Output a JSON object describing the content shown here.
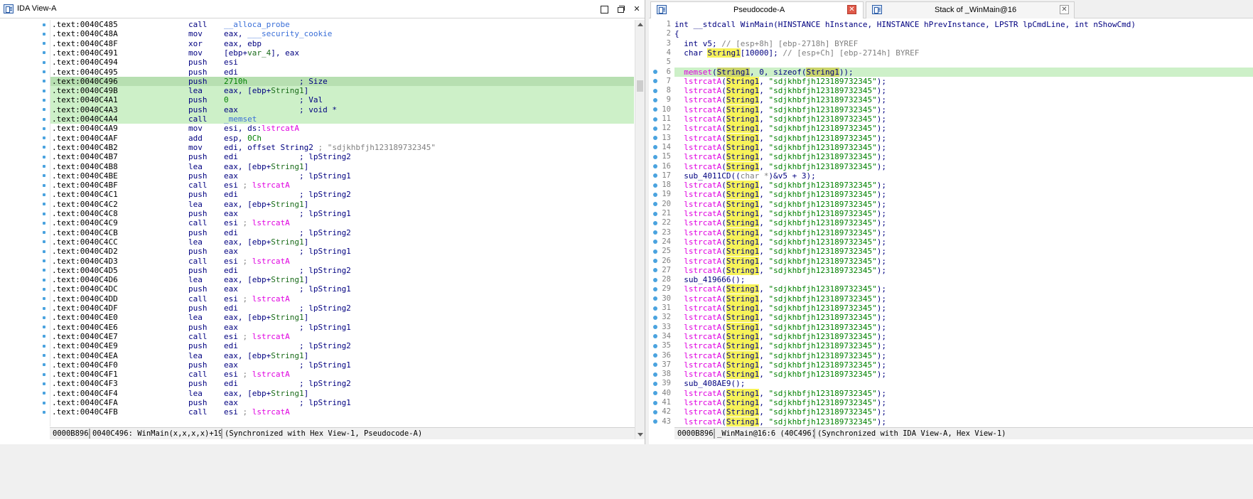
{
  "ida_view": {
    "title": "IDA View-A",
    "rows": [
      {
        "addr": ".text:0040C485",
        "mn": "call",
        "op": [
          [
            "func",
            "__alloca_probe"
          ]
        ],
        "cls": ""
      },
      {
        "addr": ".text:0040C48A",
        "mn": "mov",
        "op": [
          [
            "",
            "eax, "
          ],
          [
            "func",
            "___security_cookie"
          ]
        ],
        "cls": ""
      },
      {
        "addr": ".text:0040C48F",
        "mn": "xor",
        "op": [
          [
            "",
            "eax, ebp"
          ]
        ],
        "cls": ""
      },
      {
        "addr": ".text:0040C491",
        "mn": "mov",
        "op": [
          [
            "",
            "[ebp+"
          ],
          [
            "var",
            "var_4"
          ],
          [
            "",
            "], eax"
          ]
        ],
        "cls": ""
      },
      {
        "addr": ".text:0040C494",
        "mn": "push",
        "op": [
          [
            "",
            "esi"
          ]
        ],
        "cls": ""
      },
      {
        "addr": ".text:0040C495",
        "mn": "push",
        "op": [
          [
            "",
            "edi"
          ]
        ],
        "cls": ""
      },
      {
        "addr": ".text:0040C496",
        "mn": "push",
        "op": [
          [
            "num",
            "2710h"
          ],
          [
            "",
            "           ; Size"
          ]
        ],
        "cls": "cur"
      },
      {
        "addr": ".text:0040C49B",
        "mn": "lea",
        "op": [
          [
            "",
            "eax, [ebp+"
          ],
          [
            "var",
            "String1"
          ],
          [
            "",
            "]"
          ]
        ],
        "cls": "hl"
      },
      {
        "addr": ".text:0040C4A1",
        "mn": "push",
        "op": [
          [
            "num",
            "0"
          ],
          [
            "",
            "               ; Val"
          ]
        ],
        "cls": "hl"
      },
      {
        "addr": ".text:0040C4A3",
        "mn": "push",
        "op": [
          [
            "",
            "eax             ; void *"
          ]
        ],
        "cls": "hl"
      },
      {
        "addr": ".text:0040C4A4",
        "mn": "call",
        "op": [
          [
            "func",
            "_memset"
          ]
        ],
        "cls": "hl"
      },
      {
        "addr": ".text:0040C4A9",
        "mn": "mov",
        "op": [
          [
            "",
            "esi, ds:"
          ],
          [
            "imp",
            "lstrcatA"
          ]
        ],
        "cls": ""
      },
      {
        "addr": ".text:0040C4AF",
        "mn": "add",
        "op": [
          [
            "",
            "esp, "
          ],
          [
            "num",
            "0Ch"
          ]
        ],
        "cls": ""
      },
      {
        "addr": ".text:0040C4B2",
        "mn": "mov",
        "op": [
          [
            "",
            "edi, offset String2 "
          ],
          [
            "cm",
            "; \"sdjkhbfjh123189732345\""
          ]
        ],
        "cls": ""
      },
      {
        "addr": ".text:0040C4B7",
        "mn": "push",
        "op": [
          [
            "",
            "edi             ; lpString2"
          ]
        ],
        "cls": ""
      },
      {
        "addr": ".text:0040C4B8",
        "mn": "lea",
        "op": [
          [
            "",
            "eax, [ebp+"
          ],
          [
            "var",
            "String1"
          ],
          [
            "",
            "]"
          ]
        ],
        "cls": ""
      },
      {
        "addr": ".text:0040C4BE",
        "mn": "push",
        "op": [
          [
            "",
            "eax             ; lpString1"
          ]
        ],
        "cls": ""
      },
      {
        "addr": ".text:0040C4BF",
        "mn": "call",
        "op": [
          [
            "",
            "esi "
          ],
          [
            "cm",
            "; "
          ],
          [
            "imp",
            "lstrcatA"
          ]
        ],
        "cls": ""
      },
      {
        "addr": ".text:0040C4C1",
        "mn": "push",
        "op": [
          [
            "",
            "edi             ; lpString2"
          ]
        ],
        "cls": ""
      },
      {
        "addr": ".text:0040C4C2",
        "mn": "lea",
        "op": [
          [
            "",
            "eax, [ebp+"
          ],
          [
            "var",
            "String1"
          ],
          [
            "",
            "]"
          ]
        ],
        "cls": ""
      },
      {
        "addr": ".text:0040C4C8",
        "mn": "push",
        "op": [
          [
            "",
            "eax             ; lpString1"
          ]
        ],
        "cls": ""
      },
      {
        "addr": ".text:0040C4C9",
        "mn": "call",
        "op": [
          [
            "",
            "esi "
          ],
          [
            "cm",
            "; "
          ],
          [
            "imp",
            "lstrcatA"
          ]
        ],
        "cls": ""
      },
      {
        "addr": ".text:0040C4CB",
        "mn": "push",
        "op": [
          [
            "",
            "edi             ; lpString2"
          ]
        ],
        "cls": ""
      },
      {
        "addr": ".text:0040C4CC",
        "mn": "lea",
        "op": [
          [
            "",
            "eax, [ebp+"
          ],
          [
            "var",
            "String1"
          ],
          [
            "",
            "]"
          ]
        ],
        "cls": ""
      },
      {
        "addr": ".text:0040C4D2",
        "mn": "push",
        "op": [
          [
            "",
            "eax             ; lpString1"
          ]
        ],
        "cls": ""
      },
      {
        "addr": ".text:0040C4D3",
        "mn": "call",
        "op": [
          [
            "",
            "esi "
          ],
          [
            "cm",
            "; "
          ],
          [
            "imp",
            "lstrcatA"
          ]
        ],
        "cls": ""
      },
      {
        "addr": ".text:0040C4D5",
        "mn": "push",
        "op": [
          [
            "",
            "edi             ; lpString2"
          ]
        ],
        "cls": ""
      },
      {
        "addr": ".text:0040C4D6",
        "mn": "lea",
        "op": [
          [
            "",
            "eax, [ebp+"
          ],
          [
            "var",
            "String1"
          ],
          [
            "",
            "]"
          ]
        ],
        "cls": ""
      },
      {
        "addr": ".text:0040C4DC",
        "mn": "push",
        "op": [
          [
            "",
            "eax             ; lpString1"
          ]
        ],
        "cls": ""
      },
      {
        "addr": ".text:0040C4DD",
        "mn": "call",
        "op": [
          [
            "",
            "esi "
          ],
          [
            "cm",
            "; "
          ],
          [
            "imp",
            "lstrcatA"
          ]
        ],
        "cls": ""
      },
      {
        "addr": ".text:0040C4DF",
        "mn": "push",
        "op": [
          [
            "",
            "edi             ; lpString2"
          ]
        ],
        "cls": ""
      },
      {
        "addr": ".text:0040C4E0",
        "mn": "lea",
        "op": [
          [
            "",
            "eax, [ebp+"
          ],
          [
            "var",
            "String1"
          ],
          [
            "",
            "]"
          ]
        ],
        "cls": ""
      },
      {
        "addr": ".text:0040C4E6",
        "mn": "push",
        "op": [
          [
            "",
            "eax             ; lpString1"
          ]
        ],
        "cls": ""
      },
      {
        "addr": ".text:0040C4E7",
        "mn": "call",
        "op": [
          [
            "",
            "esi "
          ],
          [
            "cm",
            "; "
          ],
          [
            "imp",
            "lstrcatA"
          ]
        ],
        "cls": ""
      },
      {
        "addr": ".text:0040C4E9",
        "mn": "push",
        "op": [
          [
            "",
            "edi             ; lpString2"
          ]
        ],
        "cls": ""
      },
      {
        "addr": ".text:0040C4EA",
        "mn": "lea",
        "op": [
          [
            "",
            "eax, [ebp+"
          ],
          [
            "var",
            "String1"
          ],
          [
            "",
            "]"
          ]
        ],
        "cls": ""
      },
      {
        "addr": ".text:0040C4F0",
        "mn": "push",
        "op": [
          [
            "",
            "eax             ; lpString1"
          ]
        ],
        "cls": ""
      },
      {
        "addr": ".text:0040C4F1",
        "mn": "call",
        "op": [
          [
            "",
            "esi "
          ],
          [
            "cm",
            "; "
          ],
          [
            "imp",
            "lstrcatA"
          ]
        ],
        "cls": ""
      },
      {
        "addr": ".text:0040C4F3",
        "mn": "push",
        "op": [
          [
            "",
            "edi             ; lpString2"
          ]
        ],
        "cls": ""
      },
      {
        "addr": ".text:0040C4F4",
        "mn": "lea",
        "op": [
          [
            "",
            "eax, [ebp+"
          ],
          [
            "var",
            "String1"
          ],
          [
            "",
            "]"
          ]
        ],
        "cls": ""
      },
      {
        "addr": ".text:0040C4FA",
        "mn": "push",
        "op": [
          [
            "",
            "eax             ; lpString1"
          ]
        ],
        "cls": ""
      },
      {
        "addr": ".text:0040C4FB",
        "mn": "call",
        "op": [
          [
            "",
            "esi "
          ],
          [
            "cm",
            "; "
          ],
          [
            "imp",
            "lstrcatA"
          ]
        ],
        "cls": ""
      }
    ],
    "status": {
      "offset": "0000B896",
      "location": "0040C496: WinMain(x,x,x,x)+19",
      "sync": "(Synchronized with Hex View-1, Pseudocode-A)"
    }
  },
  "pseudocode": {
    "title": "Pseudocode-A",
    "second_tab_title": "Stack of _WinMain@16",
    "header_lines": [
      "int __stdcall WinMain(HINSTANCE hInstance, HINSTANCE hPrevInstance, LPSTR lpCmdLine, int nShowCmd)",
      "{"
    ],
    "decl_v5": "  int v5; ",
    "decl_v5_comment": "// [esp+8h] [ebp-2718h] BYREF",
    "decl_string1_pre": "  char ",
    "decl_string1_var": "String1",
    "decl_string1_post": "[10000]; ",
    "decl_string1_comment": "// [esp+Ch] [ebp-2714h] BYREF",
    "memset_line": {
      "fn": "memset",
      "var": "String1",
      "mid": ", 0, sizeof(",
      "end": "));"
    },
    "strcat_fn": "lstrcatA",
    "strcat_var": "String1",
    "strcat_str": "\"sdjkhbfjh123189732345\"",
    "call_line_17": {
      "pre": "  sub_4011CD((",
      "cast": "char *",
      "post": ")&v5 + 3);"
    },
    "call_line_28": "  sub_419666();",
    "call_line_39": "  sub_408AE9();",
    "line_numbers": [
      "1",
      "2",
      "3",
      "4",
      "5",
      "6",
      "7",
      "8",
      "9",
      "10",
      "11",
      "12",
      "13",
      "14",
      "15",
      "16",
      "17",
      "18",
      "19",
      "20",
      "21",
      "22",
      "23",
      "24",
      "25",
      "26",
      "27",
      "28",
      "29",
      "30",
      "31",
      "32",
      "33",
      "34",
      "35",
      "36",
      "37",
      "38",
      "39",
      "40",
      "41",
      "42",
      "43"
    ],
    "status": {
      "offset": "0000B896",
      "location": "_WinMain@16:6 (40C496)",
      "sync": "(Synchronized with IDA View-A, Hex View-1)"
    }
  },
  "icons": {
    "ida_tab": "disassembly-icon",
    "pseudo_tab": "pseudocode-icon",
    "stack_tab": "stack-icon"
  },
  "colors": {
    "highlight_green": "#cdf0c8",
    "highlight_yellow": "#f7f35a",
    "import_magenta": "#e000e0",
    "string_green": "#008000",
    "bullet_blue": "#4aa3df",
    "close_red": "#e05a4a"
  }
}
